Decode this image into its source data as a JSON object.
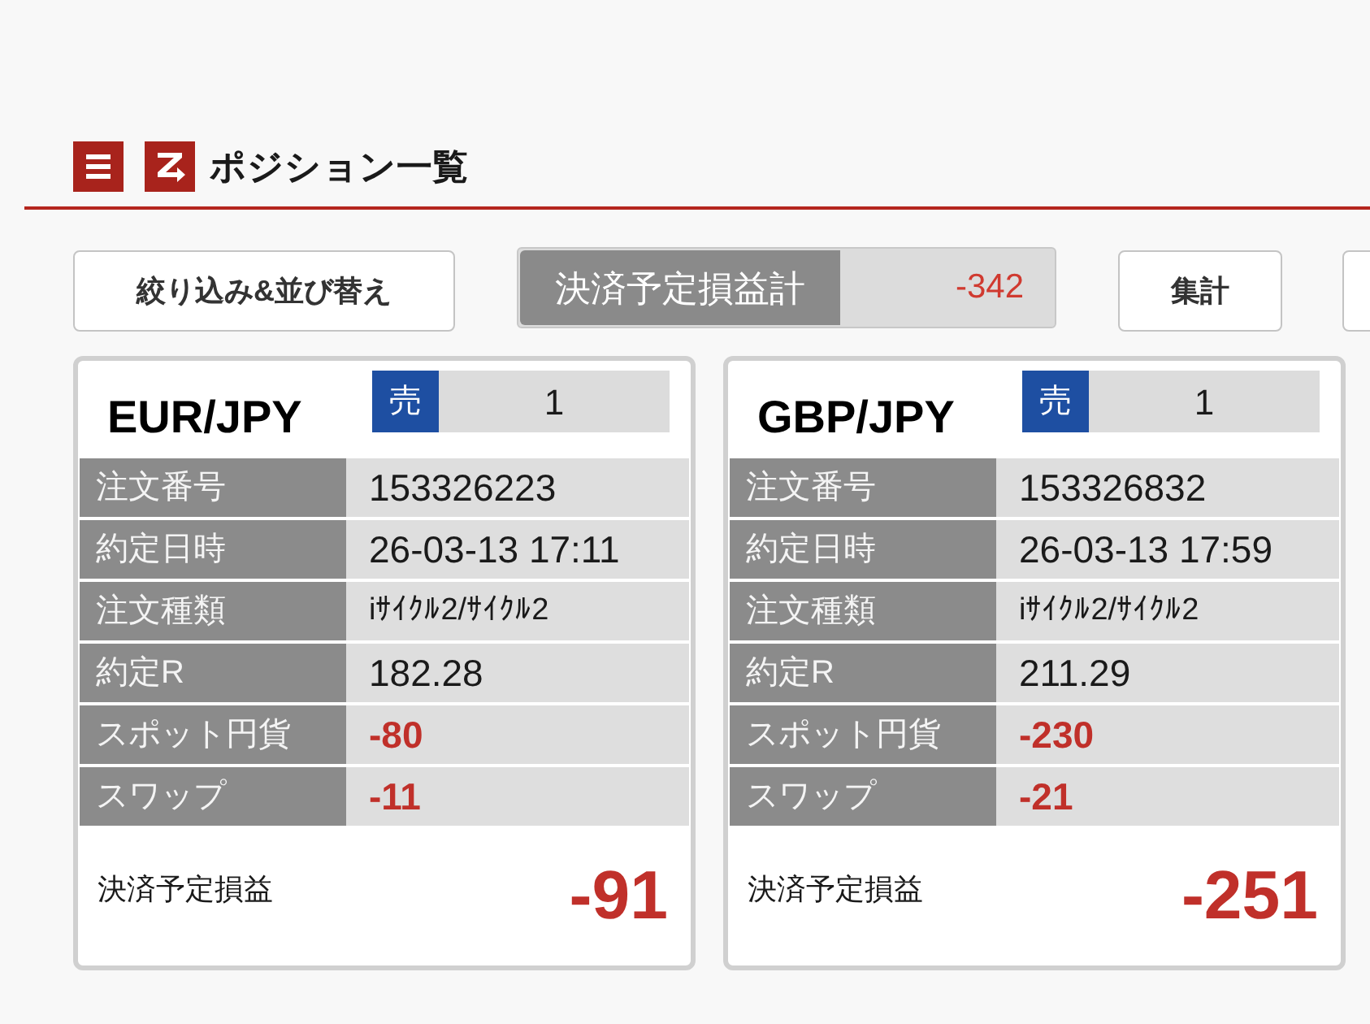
{
  "header": {
    "title": "ポジション一覧"
  },
  "toolbar": {
    "filter_button": "絞り込み&並び替え",
    "total": {
      "label": "決済予定損益計",
      "value": "-342"
    },
    "summary_button": "集計"
  },
  "positions": [
    {
      "pair": "EUR/JPY",
      "side": "売",
      "quantity": "1",
      "rows": [
        {
          "label": "注文番号",
          "value": "153326223",
          "kind": "plain"
        },
        {
          "label": "約定日時",
          "value": "26-03-13 17:11",
          "kind": "plain"
        },
        {
          "label": "注文種類",
          "value": "iｻｲｸﾙ2/ｻｲｸﾙ2",
          "kind": "small"
        },
        {
          "label": "約定R",
          "value": "182.28",
          "kind": "plain"
        },
        {
          "label": "スポット円貨",
          "value": "-80",
          "kind": "amount"
        },
        {
          "label": "スワップ",
          "value": "-11",
          "kind": "amount"
        }
      ],
      "pl_label": "決済予定損益",
      "pl_value": "-91"
    },
    {
      "pair": "GBP/JPY",
      "side": "売",
      "quantity": "1",
      "rows": [
        {
          "label": "注文番号",
          "value": "153326832",
          "kind": "plain"
        },
        {
          "label": "約定日時",
          "value": "26-03-13 17:59",
          "kind": "plain"
        },
        {
          "label": "注文種類",
          "value": "iｻｲｸﾙ2/ｻｲｸﾙ2",
          "kind": "small"
        },
        {
          "label": "約定R",
          "value": "211.29",
          "kind": "plain"
        },
        {
          "label": "スポット円貨",
          "value": "-230",
          "kind": "amount"
        },
        {
          "label": "スワップ",
          "value": "-21",
          "kind": "amount"
        }
      ],
      "pl_label": "決済予定損益",
      "pl_value": "-251"
    }
  ]
}
